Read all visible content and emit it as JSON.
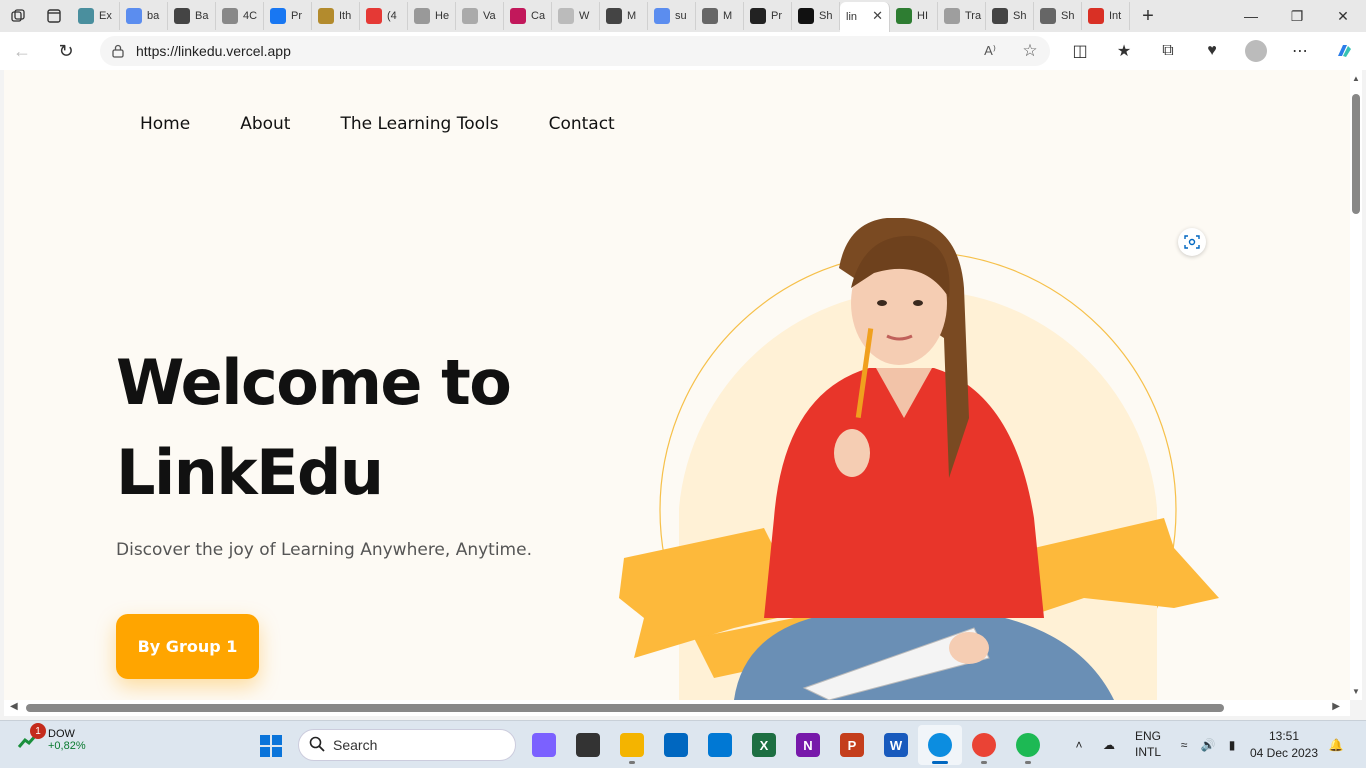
{
  "browser": {
    "tabs": [
      {
        "label": "Ex",
        "color": "#4a8f9e"
      },
      {
        "label": "ba",
        "color": "#5b8def"
      },
      {
        "label": "Ba",
        "color": "#444444"
      },
      {
        "label": "4C",
        "color": "#888888"
      },
      {
        "label": "Pr",
        "color": "#1877f2"
      },
      {
        "label": "Ith",
        "color": "#b38b2d"
      },
      {
        "label": "(4",
        "color": "#e53935"
      },
      {
        "label": "He",
        "color": "#999999"
      },
      {
        "label": "Va",
        "color": "#aaaaaa"
      },
      {
        "label": "Ca",
        "color": "#c2185b"
      },
      {
        "label": "W",
        "color": "#bbbbbb"
      },
      {
        "label": "M",
        "color": "#444444"
      },
      {
        "label": "su",
        "color": "#5b8def"
      },
      {
        "label": "M",
        "color": "#666666"
      },
      {
        "label": "Pr",
        "color": "#222222"
      },
      {
        "label": "Sh",
        "color": "#111111"
      }
    ],
    "active_tab": {
      "label": "lin",
      "close": "✕"
    },
    "tabs_after": [
      {
        "label": "HI",
        "color": "#2e7d32"
      },
      {
        "label": "Tra",
        "color": "#9e9e9e"
      },
      {
        "label": "Sh",
        "color": "#444444"
      },
      {
        "label": "Sh",
        "color": "#666666"
      },
      {
        "label": "Int",
        "color": "#d93025"
      }
    ],
    "new_tab": "+",
    "url": "https://linkedu.vercel.app",
    "read_aloud": "A⁾"
  },
  "site": {
    "nav": [
      "Home",
      "About",
      "The Learning Tools",
      "Contact"
    ],
    "title_line1": "Welcome to",
    "title_line2": "LinkEdu",
    "subtitle": "Discover the joy of Learning Anywhere, Anytime.",
    "cta": "By Group 1",
    "accent": "#ffa500"
  },
  "taskbar": {
    "weather_badge": "1",
    "ticker": "DOW",
    "ticker_change": "+0,82%",
    "search_placeholder": "Search",
    "apps": [
      {
        "name": "copilot-icon",
        "color": "#7b61ff",
        "glyph": ""
      },
      {
        "name": "task-view-icon",
        "color": "#333333",
        "glyph": ""
      },
      {
        "name": "file-explorer-icon",
        "color": "#f4b400",
        "glyph": ""
      },
      {
        "name": "microsoft-store-icon",
        "color": "#0067c0",
        "glyph": ""
      },
      {
        "name": "mail-icon",
        "color": "#0078d4",
        "glyph": ""
      },
      {
        "name": "excel-icon",
        "color": "#1d6f42",
        "glyph": "X"
      },
      {
        "name": "onenote-icon",
        "color": "#7719aa",
        "glyph": "N"
      },
      {
        "name": "powerpoint-icon",
        "color": "#c43e1c",
        "glyph": "P"
      },
      {
        "name": "word-icon",
        "color": "#185abd",
        "glyph": "W"
      },
      {
        "name": "edge-icon",
        "color": "#0c8de0",
        "glyph": ""
      },
      {
        "name": "chrome-icon",
        "color": "#ea4335",
        "glyph": ""
      },
      {
        "name": "spotify-icon",
        "color": "#1db954",
        "glyph": ""
      }
    ],
    "lang_line1": "ENG",
    "lang_line2": "INTL",
    "time": "13:51",
    "date": "04 Dec 2023"
  }
}
